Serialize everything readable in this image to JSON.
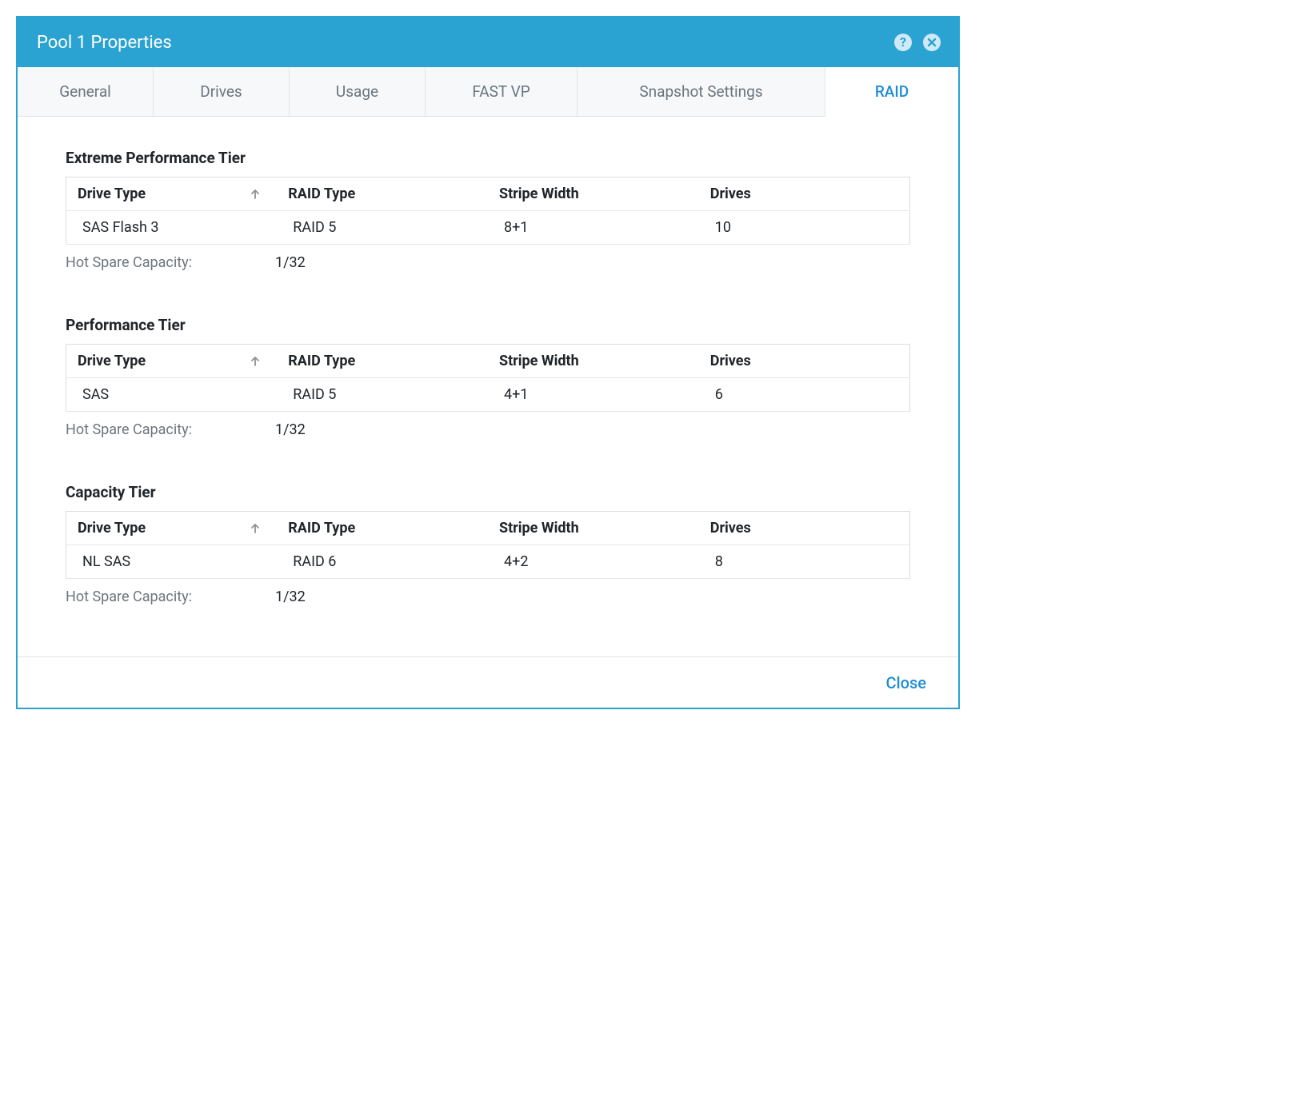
{
  "dialog": {
    "title": "Pool 1 Properties"
  },
  "tabs": {
    "general": "General",
    "drives": "Drives",
    "usage": "Usage",
    "fastvp": "FAST VP",
    "snapshot": "Snapshot Settings",
    "raid": "RAID"
  },
  "columns": {
    "drive_type": "Drive Type",
    "raid_type": "RAID Type",
    "stripe_width": "Stripe Width",
    "drives": "Drives"
  },
  "labels": {
    "hot_spare_capacity": "Hot Spare Capacity:"
  },
  "tiers": [
    {
      "title": "Extreme Performance Tier",
      "row": {
        "drive_type": "SAS Flash 3",
        "raid_type": "RAID 5",
        "stripe_width": "8+1",
        "drives": "10"
      },
      "hot_spare": "1/32"
    },
    {
      "title": "Performance Tier",
      "row": {
        "drive_type": "SAS",
        "raid_type": "RAID 5",
        "stripe_width": "4+1",
        "drives": "6"
      },
      "hot_spare": "1/32"
    },
    {
      "title": "Capacity Tier",
      "row": {
        "drive_type": "NL SAS",
        "raid_type": "RAID 6",
        "stripe_width": "4+2",
        "drives": "8"
      },
      "hot_spare": "1/32"
    }
  ],
  "footer": {
    "close": "Close"
  },
  "icons": {
    "help": "help-icon",
    "close": "close-icon",
    "sort_up": "sort-up-icon"
  }
}
